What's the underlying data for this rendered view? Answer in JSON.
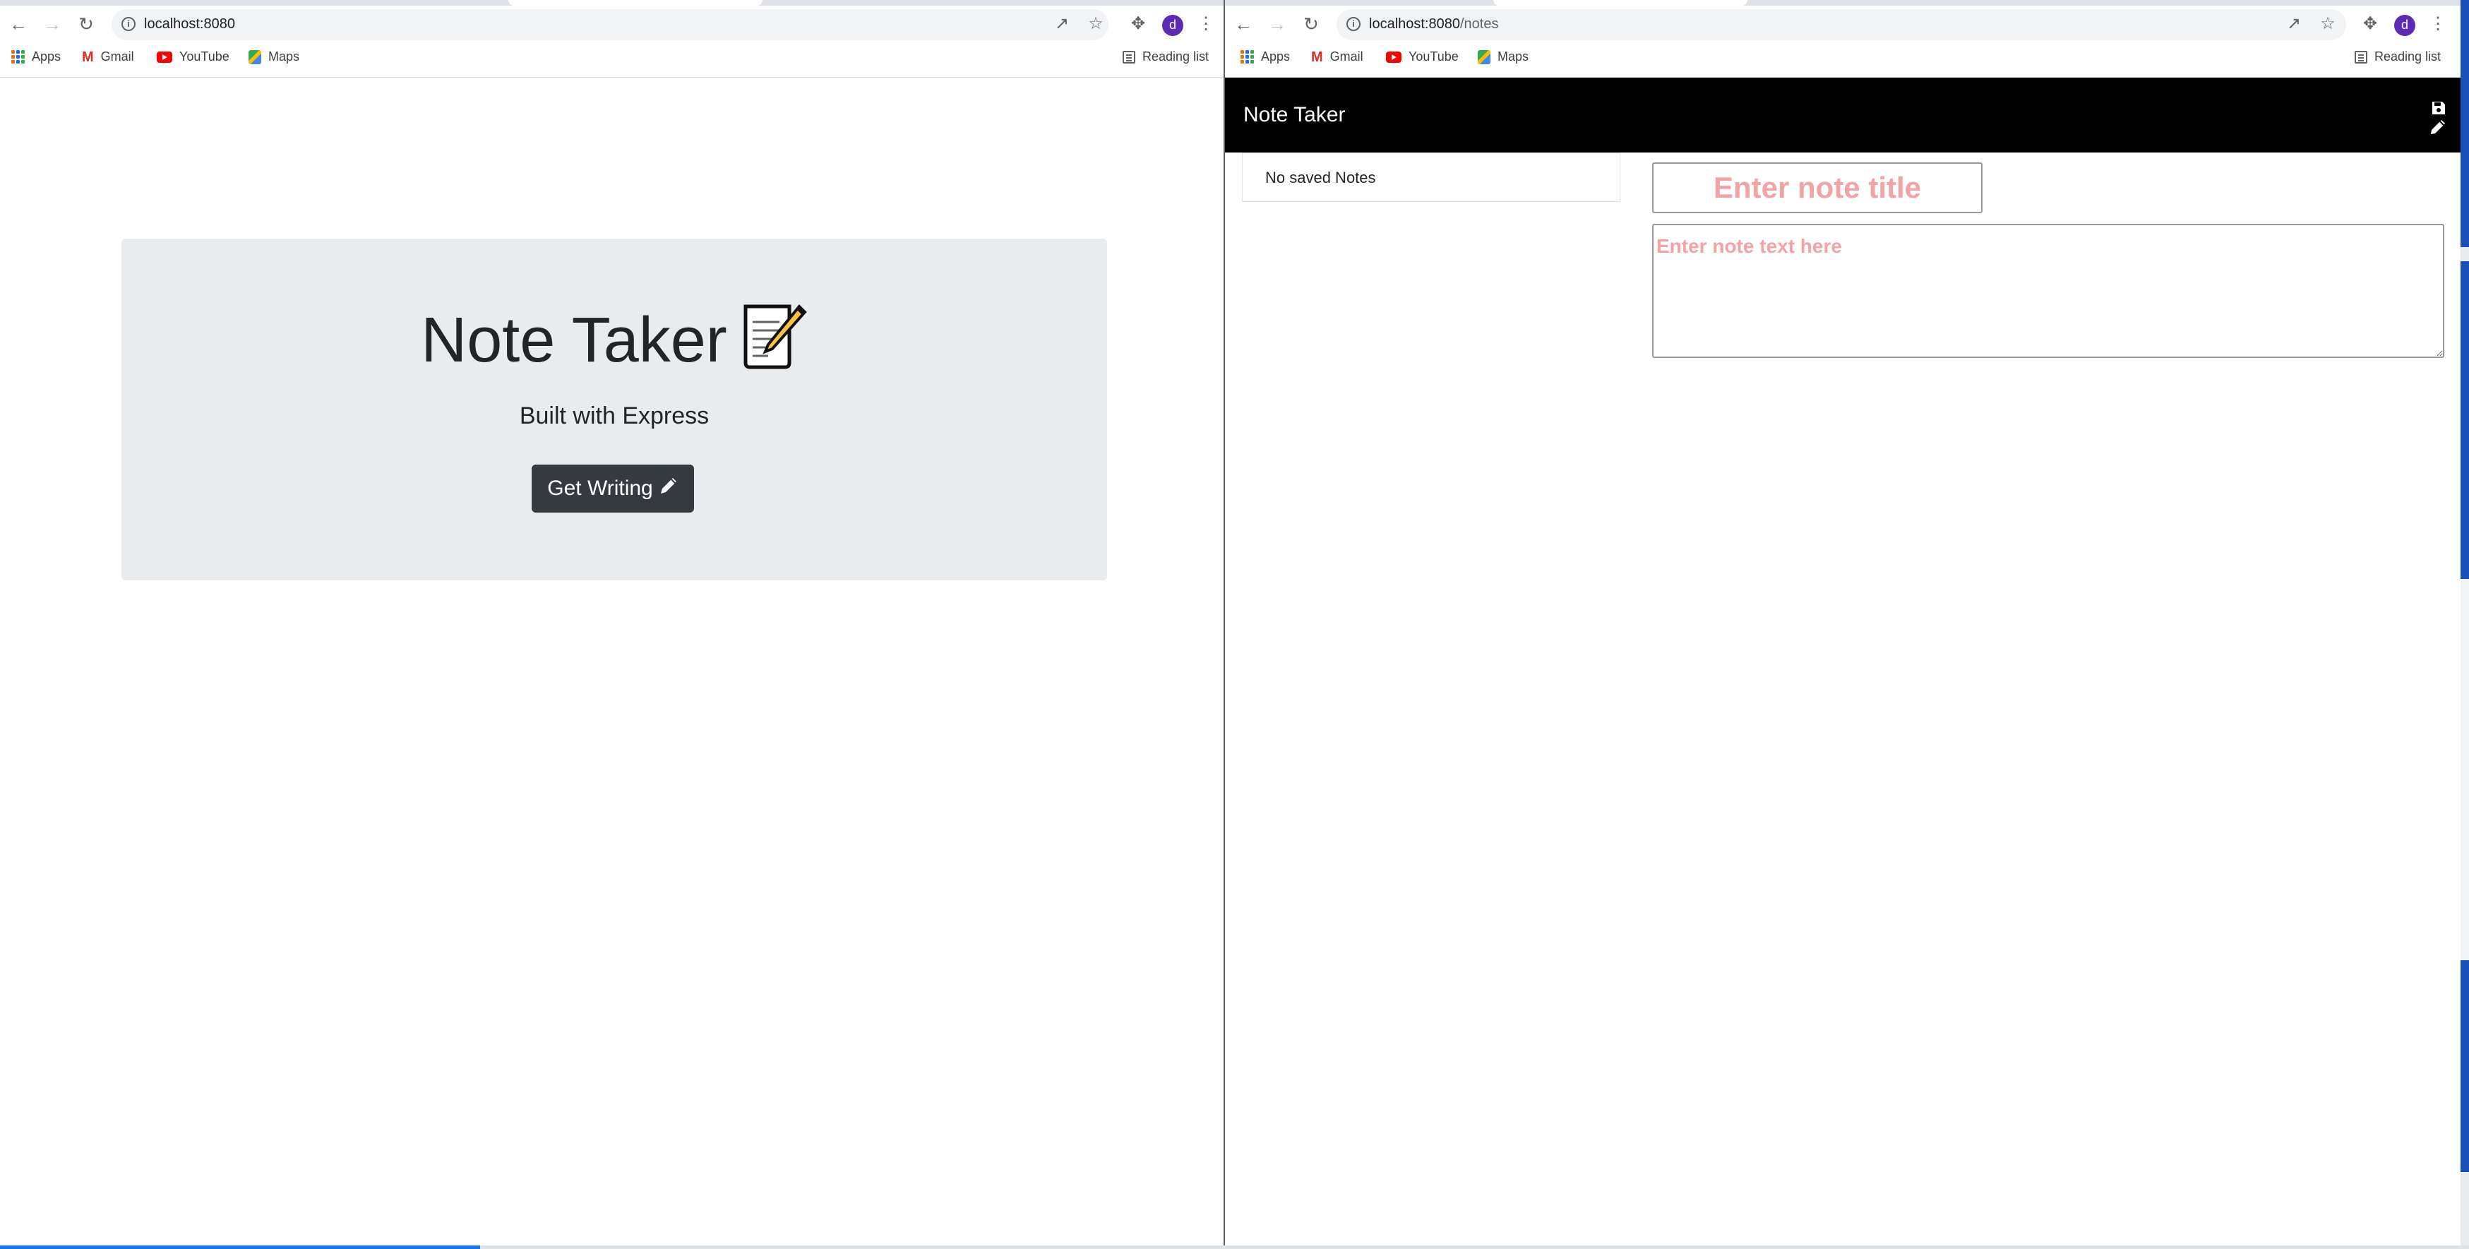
{
  "browser_left": {
    "url_host": "localhost:8080",
    "url_path": "",
    "avatar_letter": "d",
    "bookmarks": [
      "Apps",
      "Gmail",
      "YouTube",
      "Maps"
    ],
    "reading_list": "Reading list"
  },
  "browser_right": {
    "url_host": "localhost:8080",
    "url_path": "/notes",
    "avatar_letter": "d",
    "bookmarks": [
      "Apps",
      "Gmail",
      "YouTube",
      "Maps"
    ],
    "reading_list": "Reading list"
  },
  "landing": {
    "title": "Note Taker",
    "subtitle": "Built with Express",
    "cta_label": "Get Writing",
    "title_emoji_icon": "memo-icon",
    "cta_icon": "pencil-icon",
    "jumbotron_bg": "#e9ecef",
    "button_bg": "#343a40"
  },
  "notes_app": {
    "brand": "Note Taker",
    "navbar_bg": "#000000",
    "nav_icons": [
      "save-icon",
      "pencil-icon"
    ],
    "empty_list_text": "No saved Notes",
    "title_placeholder": "Enter note title",
    "text_placeholder": "Enter note text here",
    "placeholder_color": "#f2a3a3"
  }
}
